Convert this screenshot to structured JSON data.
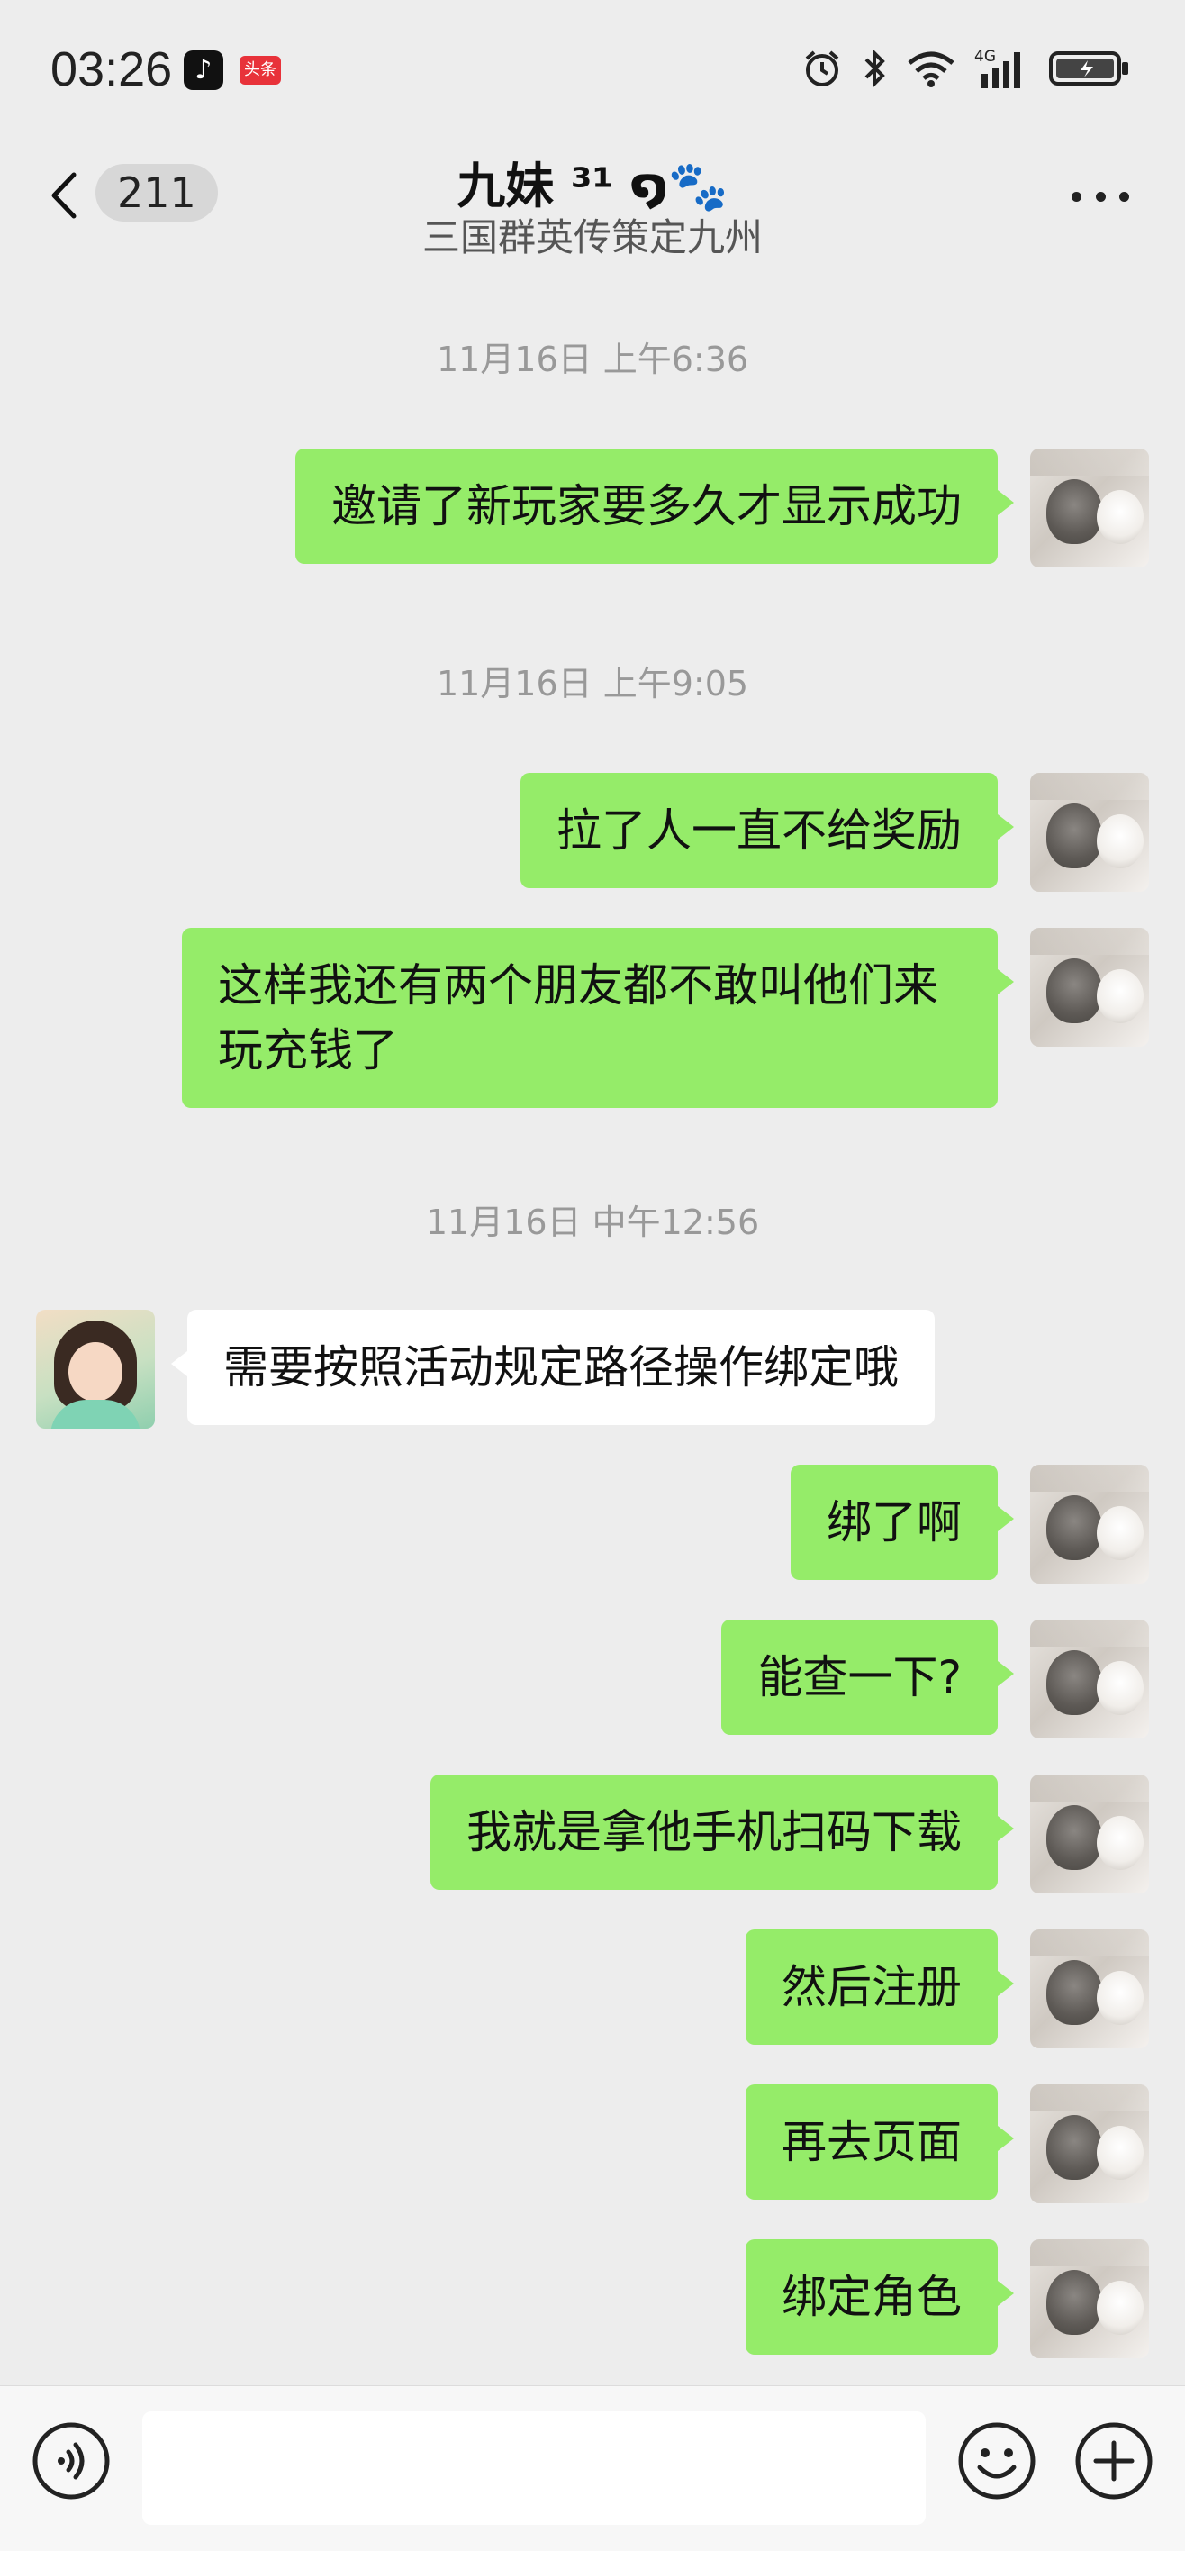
{
  "status_bar": {
    "time": "03:26",
    "app_icons": [
      "tiktok-icon",
      "toutiao-icon"
    ],
    "news_badge": "头条",
    "indicators": [
      "alarm-icon",
      "bluetooth-icon",
      "wifi-icon",
      "4g-signal-icon",
      "battery-charging-icon"
    ],
    "network": "4G"
  },
  "header": {
    "unread_count": "211",
    "title": "九妹 ³¹ ໑🐾",
    "subtitle": "三国群英传策定九州"
  },
  "colors": {
    "background": "#ededed",
    "my_bubble": "#95ec69",
    "their_bubble": "#ffffff",
    "timestamp": "#999999"
  },
  "messages": {
    "ts1": "11月16日 上午6:36",
    "m1": "邀请了新玩家要多久才显示成功",
    "ts2": "11月16日 上午9:05",
    "m2": "拉了人一直不给奖励",
    "m3": "这样我还有两个朋友都不敢叫他们来玩充钱了",
    "ts3": "11月16日 中午12:56",
    "m4": "需要按照活动规定路径操作绑定哦",
    "m5": "绑了啊",
    "m6": "能查一下?",
    "m7": "我就是拿他手机扫码下载",
    "m8": "然后注册",
    "m9": "再去页面",
    "m10": "绑定角色"
  },
  "input_bar": {
    "placeholder": ""
  }
}
